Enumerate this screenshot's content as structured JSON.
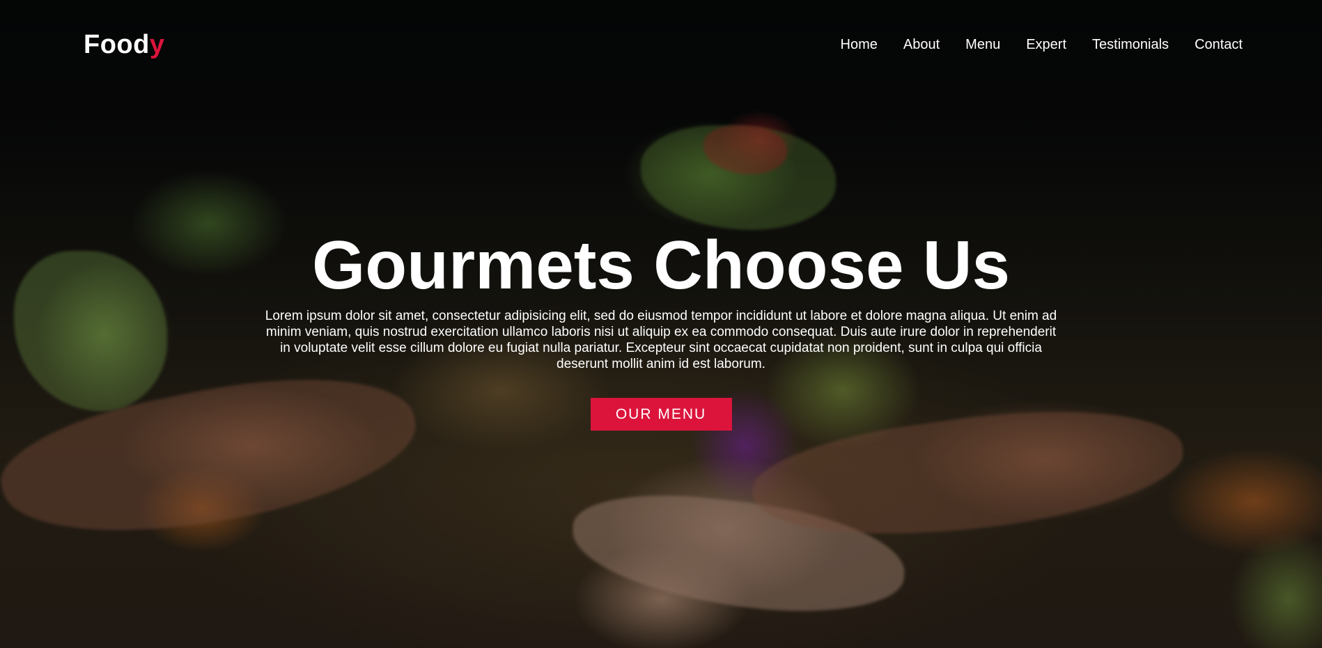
{
  "brand": {
    "logo_main": "Food",
    "logo_accent": "y",
    "accent_color": "#dc143c"
  },
  "nav": {
    "items": [
      {
        "label": "Home"
      },
      {
        "label": "About"
      },
      {
        "label": "Menu"
      },
      {
        "label": "Expert"
      },
      {
        "label": "Testimonials"
      },
      {
        "label": "Contact"
      }
    ]
  },
  "hero": {
    "title": "Gourmets Choose Us",
    "description": "Lorem ipsum dolor sit amet, consectetur adipisicing elit, sed do eiusmod tempor incididunt ut labore et dolore magna aliqua. Ut enim ad minim veniam, quis nostrud exercitation ullamco laboris nisi ut aliquip ex ea commodo consequat. Duis aute irure dolor in reprehenderit in voluptate velit esse cillum dolore eu fugiat nulla pariatur. Excepteur sint occaecat cupidatat non proident, sunt in culpa qui officia deserunt mollit anim id est laborum.",
    "cta_label": "OUR MENU"
  }
}
